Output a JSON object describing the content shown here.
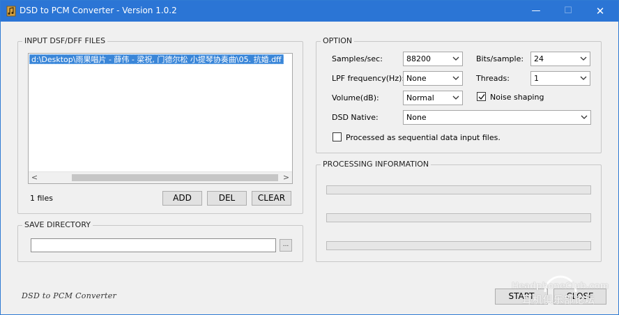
{
  "window": {
    "title": "DSD to PCM Converter - Version 1.0.2",
    "controls": {
      "minimize": "—",
      "maximize": "☐",
      "close": "✕"
    }
  },
  "input_files": {
    "group_title": "INPUT DSF/DFF FILES",
    "items": [
      "d:\\Desktop\\雨果唱片 - 薛伟 - 梁祝, 门德尔松 小提琴协奏曲\\05. 抗婚.dff"
    ],
    "count_label": "1 files",
    "add_label": "ADD",
    "del_label": "DEL",
    "clear_label": "CLEAR"
  },
  "save_directory": {
    "group_title": "SAVE DIRECTORY",
    "value": "",
    "browse_label": "..."
  },
  "option": {
    "group_title": "OPTION",
    "samples_label": "Samples/sec:",
    "samples_value": "88200",
    "bits_label": "Bits/sample:",
    "bits_value": "24",
    "lpf_label": "LPF frequency(Hz):",
    "lpf_value": "None",
    "threads_label": "Threads:",
    "threads_value": "1",
    "volume_label": "Volume(dB):",
    "volume_value": "Normal",
    "noise_shaping_label": "Noise shaping",
    "noise_shaping_checked": true,
    "dsd_native_label": "DSD Native:",
    "dsd_native_value": "None",
    "sequential_label": "Processed as sequential data input files.",
    "sequential_checked": false
  },
  "processing": {
    "group_title": "PROCESSING INFORMATION",
    "progress": [
      0,
      0,
      0
    ]
  },
  "footer": {
    "brand": "DSD to PCM Converter",
    "start_label": "START",
    "close_label": "CLOSE"
  },
  "watermark": {
    "line1": "HeadphoneClub.com",
    "line2": "耳机俱乐部论坛"
  },
  "colors": {
    "titlebar": "#2b75d5",
    "selection": "#3a86d8"
  }
}
